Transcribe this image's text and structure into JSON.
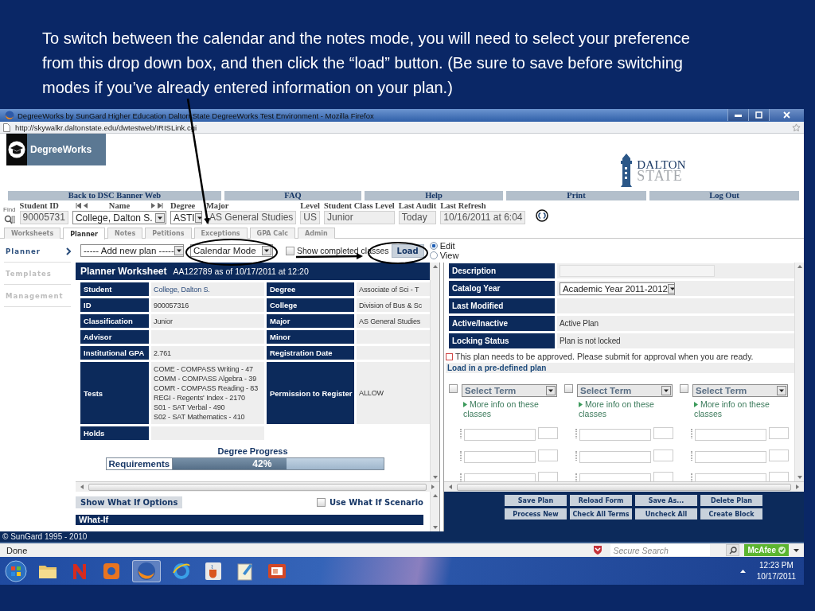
{
  "caption": "To switch between the calendar and the notes mode, you will need to select your preference from this drop down box, and then click the “load” button. (Be sure to save before switching modes if you’ve already entered information on your plan.)",
  "browser": {
    "title": "DegreeWorks by SunGard Higher Education Dalton State DegreeWorks Test Environment - Mozilla Firefox",
    "url": "http://skywalkr.daltonstate.edu/dwtestweb/IRISLink.cgi"
  },
  "header": {
    "app_name": "DegreeWorks",
    "school_logo": [
      "DALTON",
      "STATE"
    ]
  },
  "nav": [
    "Back to DSC Banner Web",
    "FAQ",
    "Help",
    "Print",
    "Log Out"
  ],
  "student_bar": {
    "find_label": "Find",
    "fields": [
      {
        "label": "Student ID",
        "value": "90005731",
        "kind": "text"
      },
      {
        "label": "Name",
        "value": "College, Dalton S.",
        "kind": "pager"
      },
      {
        "label": "Degree",
        "value": "ASTI",
        "kind": "select"
      },
      {
        "label": "Major",
        "value": "AS General Studies",
        "kind": "text"
      },
      {
        "label": "Level",
        "value": "US",
        "kind": "text"
      },
      {
        "label": "Student Class Level",
        "value": "Junior",
        "kind": "text"
      },
      {
        "label": "Last Audit",
        "value": "Today",
        "kind": "text"
      },
      {
        "label": "Last Refresh",
        "value": "10/16/2011 at 6:04",
        "kind": "text"
      }
    ]
  },
  "tabs": [
    {
      "label": "Worksheets",
      "selected": false
    },
    {
      "label": "Planner",
      "selected": true
    },
    {
      "label": "Notes",
      "selected": false
    },
    {
      "label": "Petitions",
      "selected": false
    },
    {
      "label": "Exceptions",
      "selected": false
    },
    {
      "label": "GPA Calc",
      "selected": false
    },
    {
      "label": "Admin",
      "selected": false
    }
  ],
  "sidebar": [
    {
      "label": "Planner",
      "selected": true
    },
    {
      "label": "Templates",
      "selected": false
    },
    {
      "label": "Management",
      "selected": false
    }
  ],
  "toolbar": {
    "plan_select": "----- Add new plan -----",
    "mode_select": "Calendar Mode",
    "show_completed": {
      "label": "Show completed classes",
      "checked": false
    },
    "load_button": "Load",
    "view_modes": [
      {
        "label": "Edit",
        "selected": true
      },
      {
        "label": "View",
        "selected": false
      }
    ]
  },
  "worksheet": {
    "title": "Planner Worksheet",
    "subtitle": "AA122789 as of 10/17/2011 at 12:20",
    "rows": [
      {
        "cells": [
          {
            "label": "Student",
            "value": "College, Dalton S.",
            "kind": "link"
          },
          {
            "label": "Degree",
            "value": "Associate of Sci - T",
            "kind": "text"
          }
        ]
      },
      {
        "cells": [
          {
            "label": "ID",
            "value": "900057316",
            "kind": "text"
          },
          {
            "label": "College",
            "value": "Division of Bus & Sc",
            "kind": "text"
          }
        ]
      },
      {
        "cells": [
          {
            "label": "Classification",
            "value": "Junior",
            "kind": "text"
          },
          {
            "label": "Major",
            "value": "AS General Studies",
            "kind": "text"
          }
        ]
      },
      {
        "cells": [
          {
            "label": "Advisor",
            "kind": "text"
          },
          {
            "label": "Minor",
            "kind": "text"
          }
        ]
      },
      {
        "cells": [
          {
            "label": "Institutional GPA",
            "value": "2.761",
            "kind": "text"
          },
          {
            "label": "Registration Date",
            "kind": "text"
          }
        ]
      },
      {
        "cells": [
          {
            "label": "Tests",
            "values": [
              "COME - COMPASS Writing - 47",
              "COMM - COMPASS Algebra - 39",
              "COMR - COMPASS Reading - 83",
              "REGI - Regents' Index - 2170",
              "S01 - SAT Verbal - 490",
              "S02 - SAT Mathematics - 410"
            ],
            "kind": "lines"
          },
          {
            "label": "Permission to Register",
            "value": "ALLOW",
            "kind": "text"
          }
        ]
      },
      {
        "cells": [
          {
            "label": "Holds",
            "kind": "text"
          }
        ]
      }
    ]
  },
  "degree_progress": {
    "title": "Degree Progress",
    "label": "Requirements",
    "reading": "42%",
    "level": 0.54
  },
  "what_if": {
    "button": "Show What If Options",
    "checkbox": {
      "label": "Use What If Scenario",
      "checked": false
    },
    "section_title": "What-If"
  },
  "plan": {
    "rows": [
      {
        "label": "Description",
        "kind": "input"
      },
      {
        "label": "Catalog Year",
        "kind": "select",
        "value": "Academic Year 2011-2012"
      },
      {
        "label": "Last Modified",
        "kind": "text"
      },
      {
        "label": "Active/Inactive",
        "kind": "text",
        "value": "Active Plan"
      },
      {
        "label": "Locking Status",
        "kind": "text",
        "value": "Plan is not locked"
      }
    ],
    "notice": "This plan needs to be approved. Please submit for approval when you are ready.",
    "predefined_link": "Load in a pre-defined plan",
    "terms": [
      {
        "select": "Select Term",
        "link": "More info on these classes",
        "checked": false
      },
      {
        "select": "Select Term",
        "link": "More info on these classes",
        "checked": false
      },
      {
        "select": "Select Term",
        "link": "More info on these classes",
        "checked": false
      }
    ],
    "buttons": [
      [
        "Save Plan",
        "Reload Form",
        "Save As...",
        "Delete Plan"
      ],
      [
        "Process New",
        "Check All Terms",
        "Uncheck All",
        "Create Block"
      ]
    ]
  },
  "footer": "© SunGard 1995 - 2010",
  "status": {
    "text": "Done",
    "search_placeholder": "Secure Search",
    "addon": "McAfee"
  },
  "taskbar": {
    "time": "12:23 PM",
    "date": "10/17/2011"
  }
}
